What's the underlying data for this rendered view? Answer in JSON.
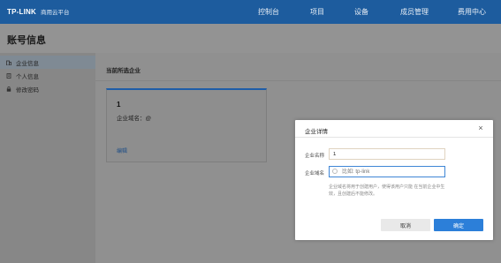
{
  "header": {
    "logo": "TP-LINK",
    "product": "商用云平台",
    "nav": [
      "控制台",
      "项目",
      "设备",
      "成员管理",
      "费用中心"
    ]
  },
  "page": {
    "title": "账号信息"
  },
  "sidebar": {
    "items": [
      {
        "label": "企业信息",
        "icon": "building-icon",
        "active": true
      },
      {
        "label": "个人信息",
        "icon": "document-icon",
        "active": false
      },
      {
        "label": "修改密码",
        "icon": "lock-icon",
        "active": false
      }
    ]
  },
  "main": {
    "section_title": "当前所选企业",
    "card": {
      "name": "1",
      "domain_label": "企业域名：@",
      "edit": "编辑"
    }
  },
  "modal": {
    "title": "企业详情",
    "close": "×",
    "name_label": "企业名称",
    "name_value": "1",
    "domain_label": "企业域名",
    "domain_placeholder": "比如: tp-link",
    "hint": "企业域名将用于创建用户，使得该用户只能 在当前企业中生效，且创建后不能修改。",
    "cancel": "取消",
    "ok": "确定"
  },
  "colors": {
    "header_bg": "#1d5c9e",
    "accent": "#2c7fd9",
    "overlay": "#909090"
  }
}
